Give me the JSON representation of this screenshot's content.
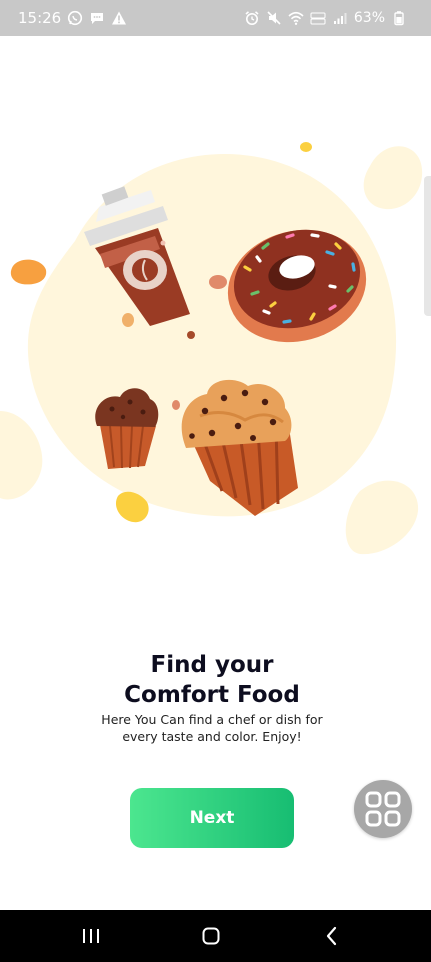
{
  "status_bar": {
    "time": "15:26",
    "battery_percent": "63%",
    "left_icons": [
      "whatsapp-icon",
      "chat-bubble-icon",
      "warning-icon"
    ],
    "right_icons": [
      "alarm-icon",
      "mute-icon",
      "wifi-icon",
      "volte-icon",
      "signal-icon",
      "battery-icon"
    ],
    "background_color": "#c8c8c8"
  },
  "onboarding": {
    "illustration_icons": [
      "coffee-cup-icon",
      "donut-icon",
      "small-muffin-icon",
      "large-muffin-icon"
    ],
    "title_line1": "Find your",
    "title_line2": "Comfort Food",
    "subtitle_line1": "Here You Can find a chef or dish for",
    "subtitle_line2": "every taste and color. Enjoy!",
    "next_label": "Next",
    "accent_start": "#4ce68f",
    "accent_end": "#17bd72"
  },
  "floating_assistant": {
    "icon": "apps-grid-icon"
  },
  "nav_bar": {
    "icons": [
      "recent-apps-icon",
      "home-icon",
      "back-icon"
    ]
  }
}
